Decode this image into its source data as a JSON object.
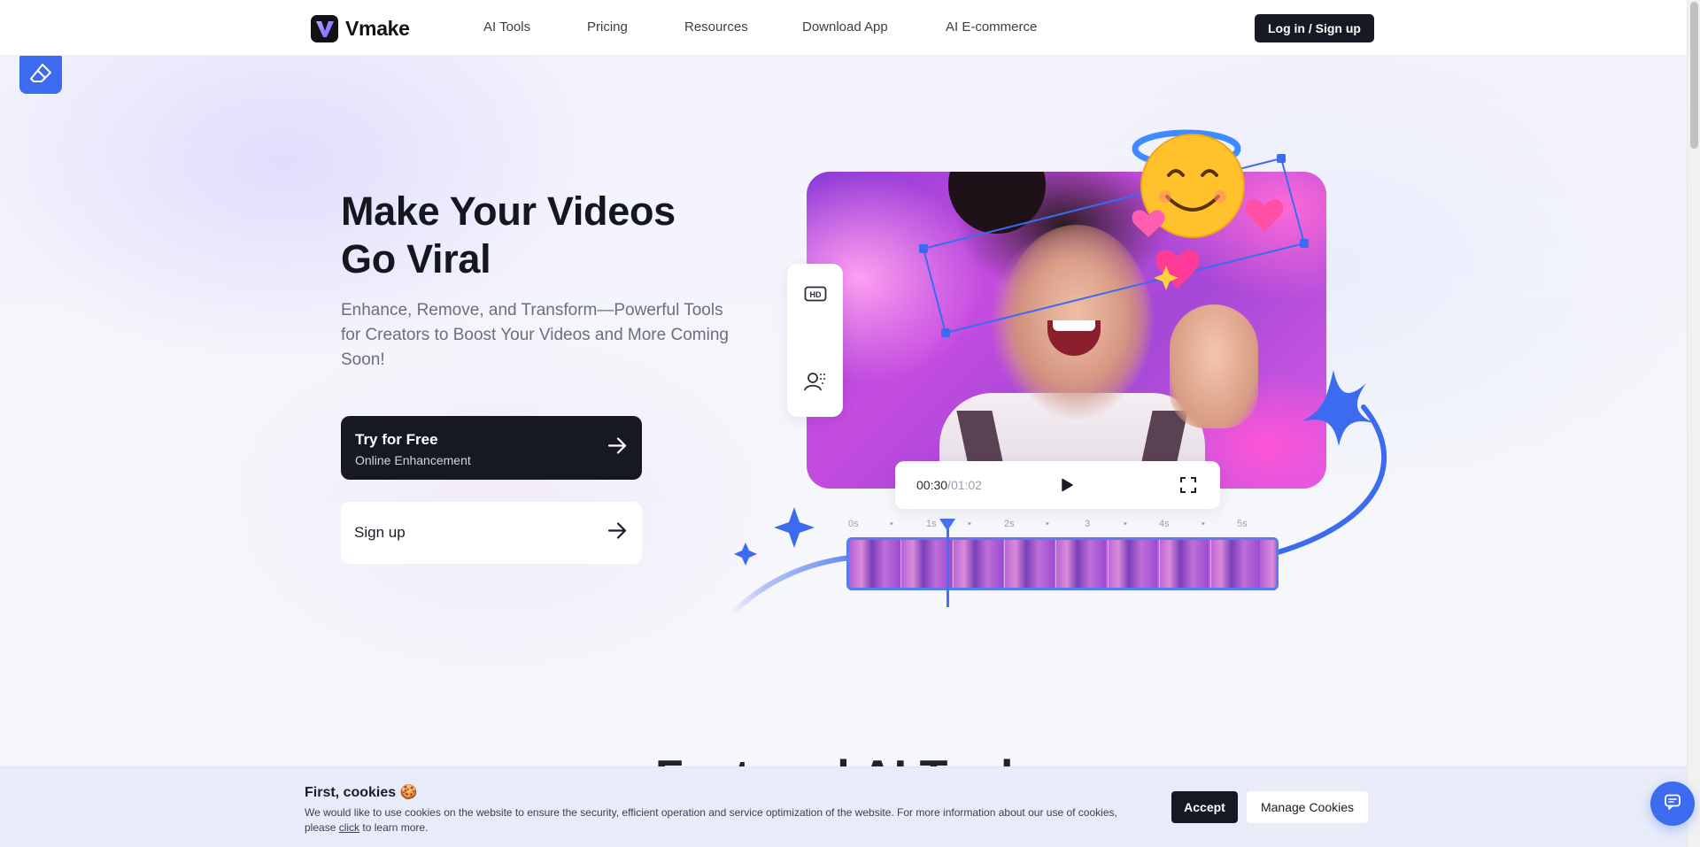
{
  "header": {
    "brand": "Vmake",
    "nav": [
      "AI Tools",
      "Pricing",
      "Resources",
      "Download App",
      "AI E-commerce"
    ],
    "login_label": "Log in / Sign up"
  },
  "hero": {
    "title_line1": "Make Your Videos",
    "title_line2": "Go Viral",
    "subtitle": "Enhance, Remove, and Transform—Powerful Tools for Creators to Boost Your Videos and More Coming Soon!",
    "cta_primary_title": "Try for Free",
    "cta_primary_sub": "Online Enhancement",
    "cta_secondary": "Sign up"
  },
  "player": {
    "current_time": "00:30",
    "separator": "/",
    "total_time": "01:02"
  },
  "timeline": {
    "labels": [
      "0s",
      "•",
      "1s",
      "•",
      "2s",
      "•",
      "3",
      "•",
      "4s",
      "•",
      "5s"
    ]
  },
  "tools": {
    "icons": [
      "hd-icon",
      "eraser-icon",
      "avatar-swap-icon"
    ],
    "accent": "#3d6bef"
  },
  "section": {
    "heading_partial": "Featured AI Tools"
  },
  "cookie": {
    "title": "First, cookies 🍪",
    "text_before": "We would like to use cookies on the website to ensure the security, efficient operation and service optimization of the website. For more information about our use of cookies, please ",
    "link": "click",
    "text_after": " to learn more.",
    "accept_label": "Accept",
    "manage_label": "Manage Cookies"
  },
  "colors": {
    "brand_dark": "#161823",
    "accent_blue": "#3d6bef",
    "cookie_bg": "#e7ecf8"
  }
}
